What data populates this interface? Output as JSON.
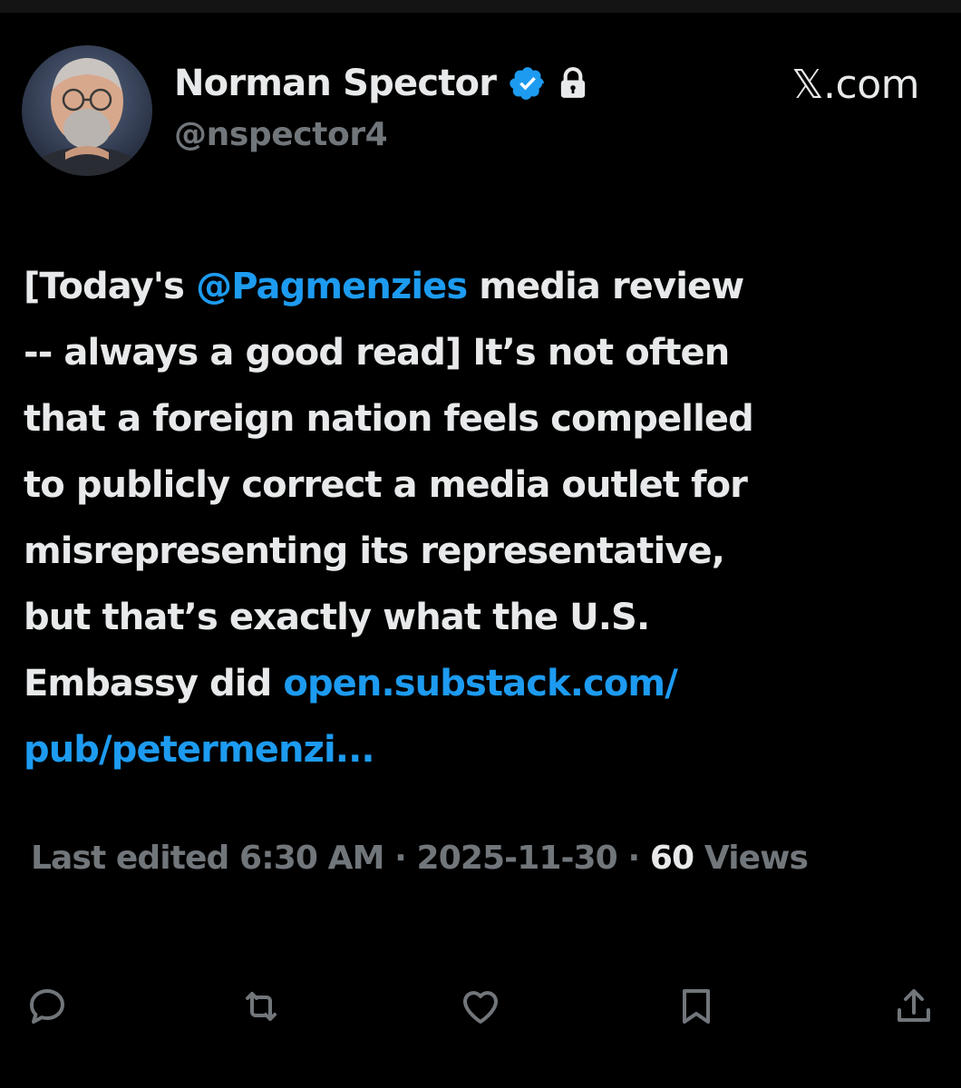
{
  "author": {
    "display_name": "Norman Spector",
    "handle": "@nspector4",
    "verified": true,
    "protected": true
  },
  "site_label": "𝕏.com",
  "tweet": {
    "lines": [
      [
        {
          "text": "[Today's "
        },
        {
          "text": "@Pagmenzies",
          "type": "mention"
        },
        {
          "text": " media review"
        }
      ],
      [
        {
          "text": "-- always a good read] It’s not often"
        }
      ],
      [
        {
          "text": "that a foreign nation feels compelled"
        }
      ],
      [
        {
          "text": "to publicly correct a media outlet for"
        }
      ],
      [
        {
          "text": "misrepresenting its representative,"
        }
      ],
      [
        {
          "text": "but that’s exactly what the U.S."
        }
      ],
      [
        {
          "text": "Embassy did "
        },
        {
          "text": "open.substack.com/",
          "type": "link"
        }
      ],
      [
        {
          "text": "pub/petermenzi...",
          "type": "link"
        }
      ]
    ]
  },
  "meta": {
    "edited_time": "Last edited 6:30 AM · 2025-11-30",
    "separator": " ·",
    "views_count": "60",
    "views_label": "Views"
  },
  "actions": [
    {
      "name": "reply-icon"
    },
    {
      "name": "repost-icon"
    },
    {
      "name": "like-icon"
    },
    {
      "name": "bookmark-icon"
    },
    {
      "name": "share-icon"
    }
  ],
  "colors": {
    "background": "#000000",
    "text": "#e7e9ea",
    "muted": "#71767b",
    "accent": "#1d9bf0"
  }
}
